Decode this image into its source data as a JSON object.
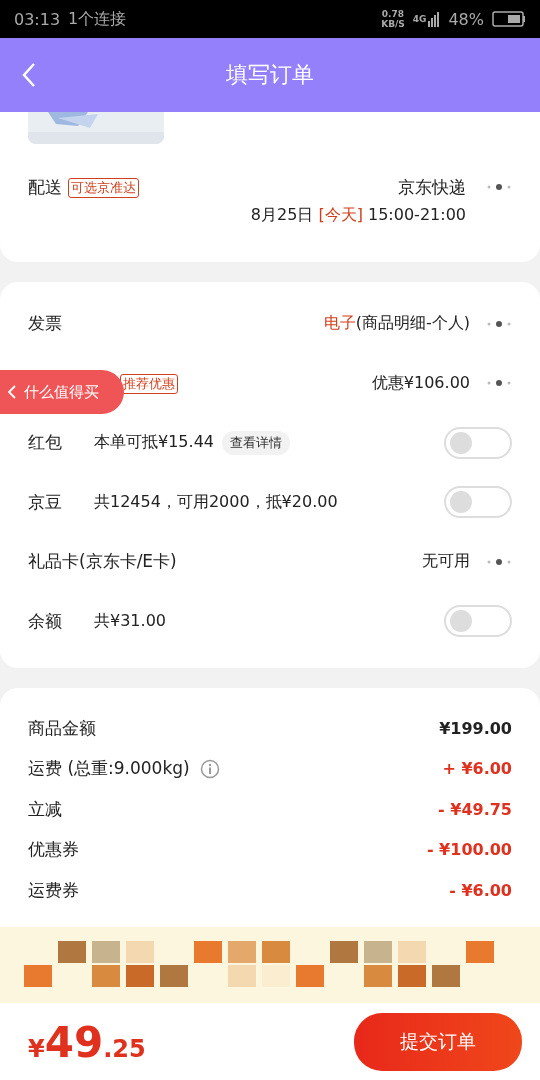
{
  "status_bar": {
    "time": "03:13",
    "notice": "1个连接",
    "speed": "0.78",
    "speed_unit": "KB/S",
    "network": "4G",
    "battery": "48%"
  },
  "header": {
    "title": "填写订单"
  },
  "delivery": {
    "label": "配送",
    "tag": "可选京准达",
    "carrier": "京东快递",
    "date": "8月25日",
    "day": "[今天]",
    "time": "15:00-21:00"
  },
  "options": [
    {
      "kind": "value",
      "label": "发票",
      "value": "**电子**(商品明细-个人)"
    },
    {
      "kind": "value",
      "tag": "推荐优惠",
      "value": "优惠¥106.00"
    },
    {
      "kind": "toggle",
      "label": "红包",
      "detail": "本单可抵¥15.44",
      "link": "查看详情",
      "on": false
    },
    {
      "kind": "toggle",
      "label": "京豆",
      "detail": "共12454，可用2000，抵¥20.00",
      "on": false
    },
    {
      "kind": "value",
      "label": "礼品卡(京东卡/E卡)",
      "value": "无可用"
    },
    {
      "kind": "toggle",
      "label": "余额",
      "detail": "共¥31.00",
      "on": false
    }
  ],
  "floating_button": {
    "label": "什么值得买"
  },
  "summary": [
    {
      "label": "商品金额",
      "amount": "¥199.00",
      "highlight": false
    },
    {
      "label": "运费 (总重:9.000kg)",
      "info": true,
      "amount": "+ ¥6.00",
      "highlight": true
    },
    {
      "label": "立减",
      "amount": "- ¥49.75",
      "highlight": true
    },
    {
      "label": "优惠券",
      "amount": "- ¥100.00",
      "highlight": true
    },
    {
      "label": "运费券",
      "amount": "- ¥6.00",
      "highlight": true
    }
  ],
  "footer": {
    "currency": "¥",
    "price_int": "49",
    "price_dec": ".25",
    "submit": "提交订单"
  }
}
